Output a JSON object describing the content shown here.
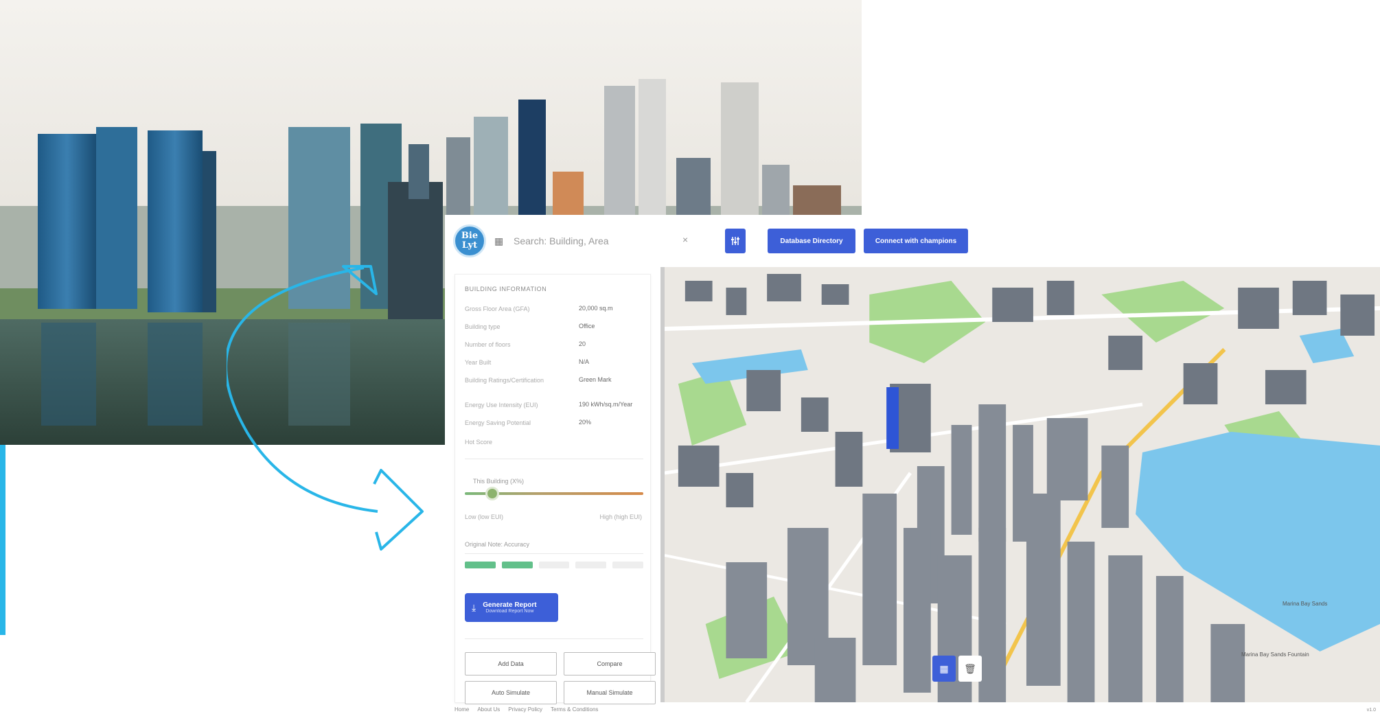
{
  "app": {
    "logo_line1": "Bie",
    "logo_line2": "Lyt",
    "search_placeholder": "Search: Building, Area",
    "buttons": {
      "directory": "Database Directory",
      "connect": "Connect with champions"
    }
  },
  "panel": {
    "section_title": "BUILDING INFORMATION",
    "info": [
      {
        "label": "Gross Floor Area (GFA)",
        "value": "20,000 sq.m"
      },
      {
        "label": "Building type",
        "value": "Office"
      },
      {
        "label": "Number of floors",
        "value": "20"
      },
      {
        "label": "Year Built",
        "value": "N/A"
      },
      {
        "label": "Building Ratings/Certification",
        "value": "Green Mark"
      },
      {
        "label": "Energy Use Intensity (EUI)",
        "value": "190 kWh/sq.m/Year"
      },
      {
        "label": "Energy Saving Potential",
        "value": "20%"
      }
    ],
    "more_label": "Hot Score",
    "slider": {
      "label": "This Building (X%)",
      "min_label": "Low (low EUI)",
      "max_label": "High (high EUI)",
      "level": 0.12
    },
    "signal_label": "Original Note: Accuracy",
    "signal_bars": {
      "filled": 2,
      "total": 5
    },
    "generate": {
      "title": "Generate Report",
      "subtitle": "Download Report Now"
    },
    "actions": [
      "Add Data",
      "Compare",
      "Auto Simulate",
      "Manual Simulate"
    ]
  },
  "footer": {
    "links": [
      "Home",
      "About Us",
      "Privacy Policy",
      "Terms & Conditions"
    ],
    "corner": "v1.0"
  },
  "map": {
    "labels": [
      "Marina Bay Sands",
      "Marina Bay Sands Fountain"
    ]
  },
  "colors": {
    "accent": "#29b6e8",
    "primary": "#3d5fd8",
    "water": "#7cc6ec",
    "park": "#a8d98f",
    "building": "#6f7782"
  }
}
